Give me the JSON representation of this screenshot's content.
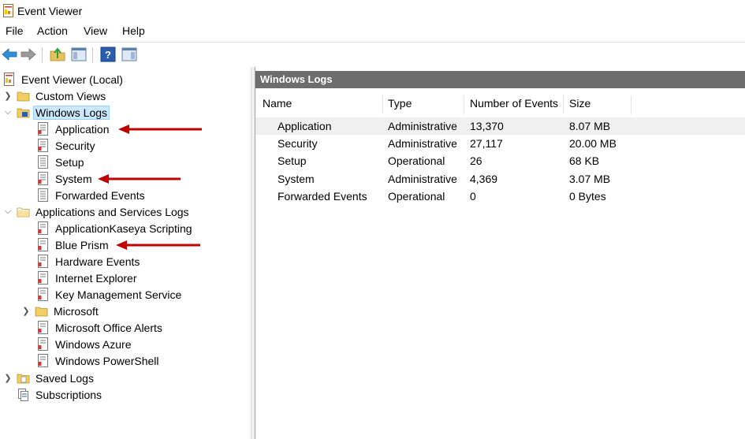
{
  "window": {
    "title": "Event Viewer"
  },
  "menu": {
    "items": [
      "File",
      "Action",
      "View",
      "Help"
    ]
  },
  "tree": {
    "root": "Event Viewer (Local)",
    "custom_views": "Custom Views",
    "windows_logs": "Windows Logs",
    "windows_logs_children": [
      "Application",
      "Security",
      "Setup",
      "System",
      "Forwarded Events"
    ],
    "apps_services": "Applications and Services Logs",
    "apps_services_children": [
      "ApplicationKaseya Scripting",
      "Blue Prism",
      "Hardware Events",
      "Internet Explorer",
      "Key Management Service",
      "Microsoft",
      "Microsoft Office Alerts",
      "Windows Azure",
      "Windows PowerShell"
    ],
    "saved_logs": "Saved Logs",
    "subscriptions": "Subscriptions"
  },
  "main": {
    "header": "Windows Logs",
    "columns": [
      "Name",
      "Type",
      "Number of Events",
      "Size"
    ],
    "rows": [
      [
        "Application",
        "Administrative",
        "13,370",
        "8.07 MB"
      ],
      [
        "Security",
        "Administrative",
        "27,117",
        "20.00 MB"
      ],
      [
        "Setup",
        "Operational",
        "26",
        "68 KB"
      ],
      [
        "System",
        "Administrative",
        "4,369",
        "3.07 MB"
      ],
      [
        "Forwarded Events",
        "Operational",
        "0",
        "0 Bytes"
      ]
    ]
  },
  "colors": {
    "accent_select": "#cce8ff",
    "header_bg": "#6d6d6d",
    "arrow": "#c00000"
  },
  "icons": {
    "back": "back-arrow-icon",
    "forward": "forward-arrow-icon",
    "log": "log-icon",
    "folder": "folder-icon"
  }
}
